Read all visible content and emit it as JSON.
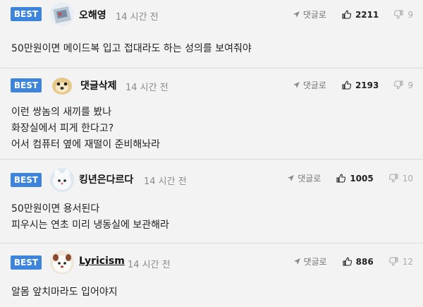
{
  "comments": [
    {
      "badge": "BEST",
      "username": "오해영",
      "time": "14 시간 전",
      "reply_label": "댓글로",
      "likes": "2211",
      "dislikes": "9",
      "text": [
        "50만원이면 메이드복 입고 접대라도 하는 성의를 보여줘야"
      ]
    },
    {
      "badge": "BEST",
      "username": "댓글삭제",
      "time": "14 시간 전",
      "reply_label": "댓글로",
      "likes": "2193",
      "dislikes": "9",
      "text": [
        "이런 쌍놈의 새끼를 봤나",
        "화장실에서 피게 한다고?",
        "어서 컴퓨터 옆에 재떨이 준비해놔라"
      ]
    },
    {
      "badge": "BEST",
      "username": "킹년은다르다",
      "time": "14 시간 전",
      "reply_label": "댓글로",
      "likes": "1005",
      "dislikes": "10",
      "text": [
        "50만원이면 용서된다",
        "피우시는 연초 미리 냉동실에 보관해라"
      ]
    },
    {
      "badge": "BEST",
      "username": "Lyricism",
      "time": "14 시간 전",
      "reply_label": "댓글로",
      "likes": "886",
      "dislikes": "12",
      "text": [
        "알몸 앞치마라도 입어야지"
      ]
    }
  ],
  "colors": {
    "badge": "#3d84dc",
    "background": "#f3f3f3",
    "divider": "#d9d9d9"
  }
}
